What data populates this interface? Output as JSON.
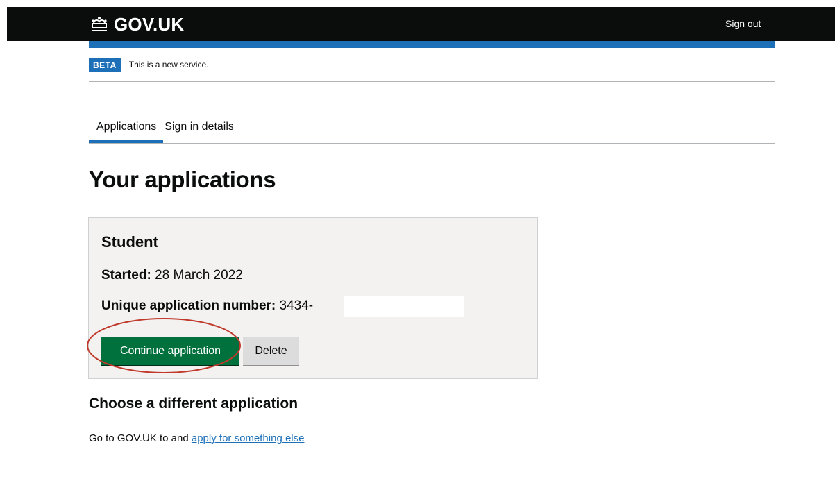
{
  "header": {
    "logo_text": "GOV.UK",
    "logo_icon": "crown-icon",
    "sign_out_label": "Sign out"
  },
  "phase_banner": {
    "tag": "BETA",
    "text": "This is a new service."
  },
  "tabs": [
    {
      "label": "Applications",
      "active": true
    },
    {
      "label": "Sign in details",
      "active": false
    }
  ],
  "main": {
    "title": "Your applications",
    "application": {
      "type": "Student",
      "started_label": "Started:",
      "started_value": "28 March 2022",
      "number_label": "Unique application number:",
      "number_value": "3434-",
      "continue_label": "Continue application",
      "delete_label": "Delete"
    },
    "other": {
      "heading": "Choose a different application",
      "text_prefix": "Go to GOV.UK to and",
      "link_text": "apply for something else"
    }
  },
  "colors": {
    "header_bg": "#0b0c0c",
    "brand_blue": "#1d70b8",
    "button_green": "#00703c",
    "annotation_red": "#c0392b"
  }
}
